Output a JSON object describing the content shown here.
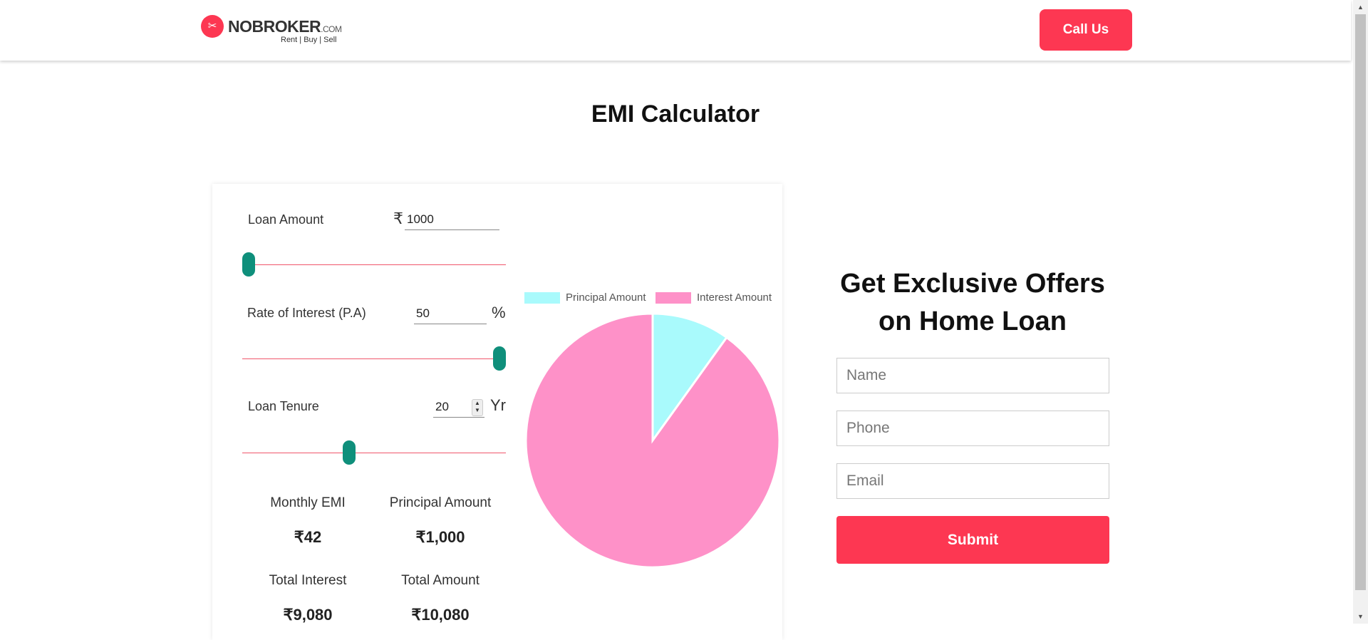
{
  "header": {
    "logo_text": "NOBROKER",
    "logo_suffix": ".COM",
    "logo_tagline": "Rent | Buy | Sell",
    "call_button": "Call Us"
  },
  "page_title": "EMI Calculator",
  "calculator": {
    "loan_amount": {
      "label": "Loan Amount",
      "currency_symbol": "₹",
      "value": "1000",
      "slider_level": 0.0
    },
    "interest_rate": {
      "label": "Rate of Interest (P.A)",
      "unit": "%",
      "value": "50",
      "slider_level": 1.0
    },
    "loan_tenure": {
      "label": "Loan Tenure",
      "unit": "Yr",
      "value": "20",
      "slider_level": 0.4
    },
    "results": {
      "monthly_emi": {
        "label": "Monthly EMI",
        "value": "₹42"
      },
      "principal_amount": {
        "label": "Principal Amount",
        "value": "₹1,000"
      },
      "total_interest": {
        "label": "Total Interest",
        "value": "₹9,080"
      },
      "total_amount": {
        "label": "Total Amount",
        "value": "₹10,080"
      }
    }
  },
  "chart_data": {
    "type": "pie",
    "categories": [
      "Principal Amount",
      "Interest Amount"
    ],
    "values": [
      1000,
      9080
    ],
    "colors": [
      "#a9fafc",
      "#fe91c8"
    ],
    "legend_position": "top"
  },
  "offers": {
    "title_line1": "Get Exclusive Offers",
    "title_line2": "on Home Loan",
    "name_placeholder": "Name",
    "phone_placeholder": "Phone",
    "email_placeholder": "Email",
    "submit_label": "Submit"
  },
  "colors": {
    "brand": "#fd3752",
    "slider_thumb": "#0f8f7b",
    "slider_track": "#f0566b"
  }
}
